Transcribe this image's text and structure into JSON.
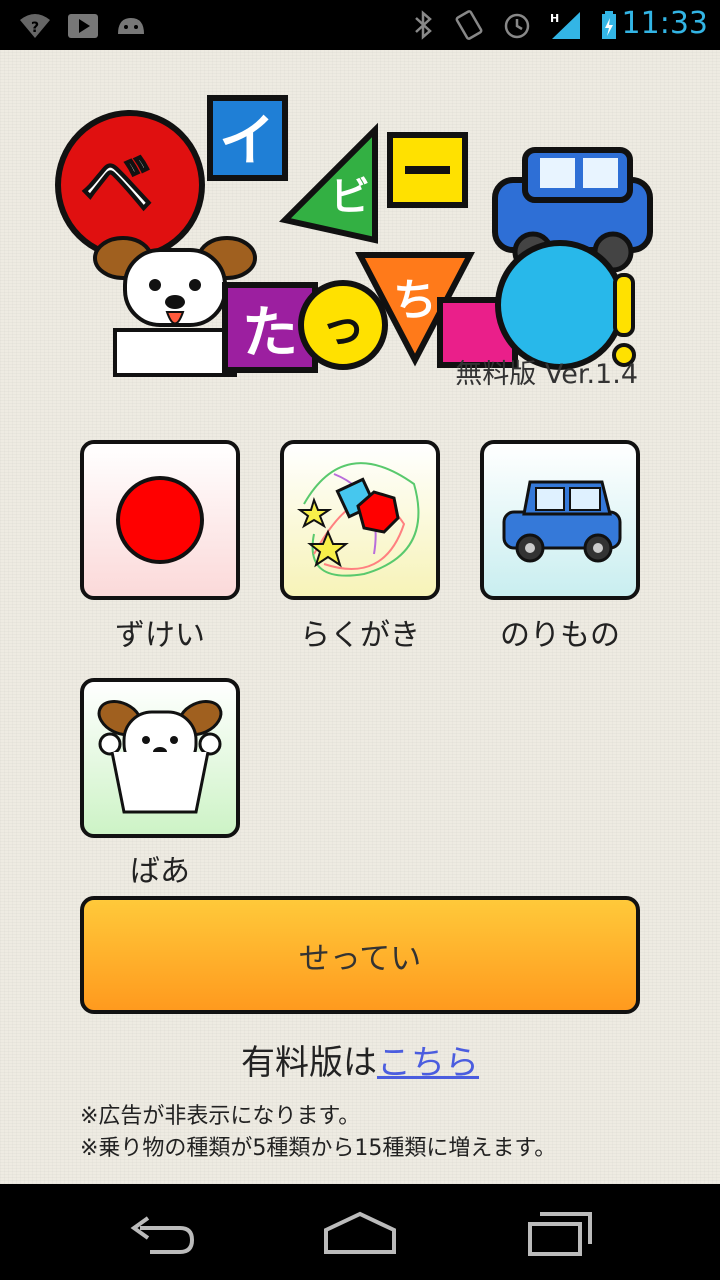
{
  "status_bar": {
    "time": "11:33"
  },
  "header": {
    "version": "無料版 Ver.1.4"
  },
  "menu": {
    "items": [
      {
        "label": "ずけい"
      },
      {
        "label": "らくがき"
      },
      {
        "label": "のりもの"
      },
      {
        "label": "ばあ"
      }
    ]
  },
  "settings": {
    "label": "せってい"
  },
  "paid": {
    "prefix": "有料版は",
    "link": "こちら",
    "notes": [
      "※広告が非表示になります。",
      "※乗り物の種類が5種類から15種類に増えます。"
    ]
  }
}
